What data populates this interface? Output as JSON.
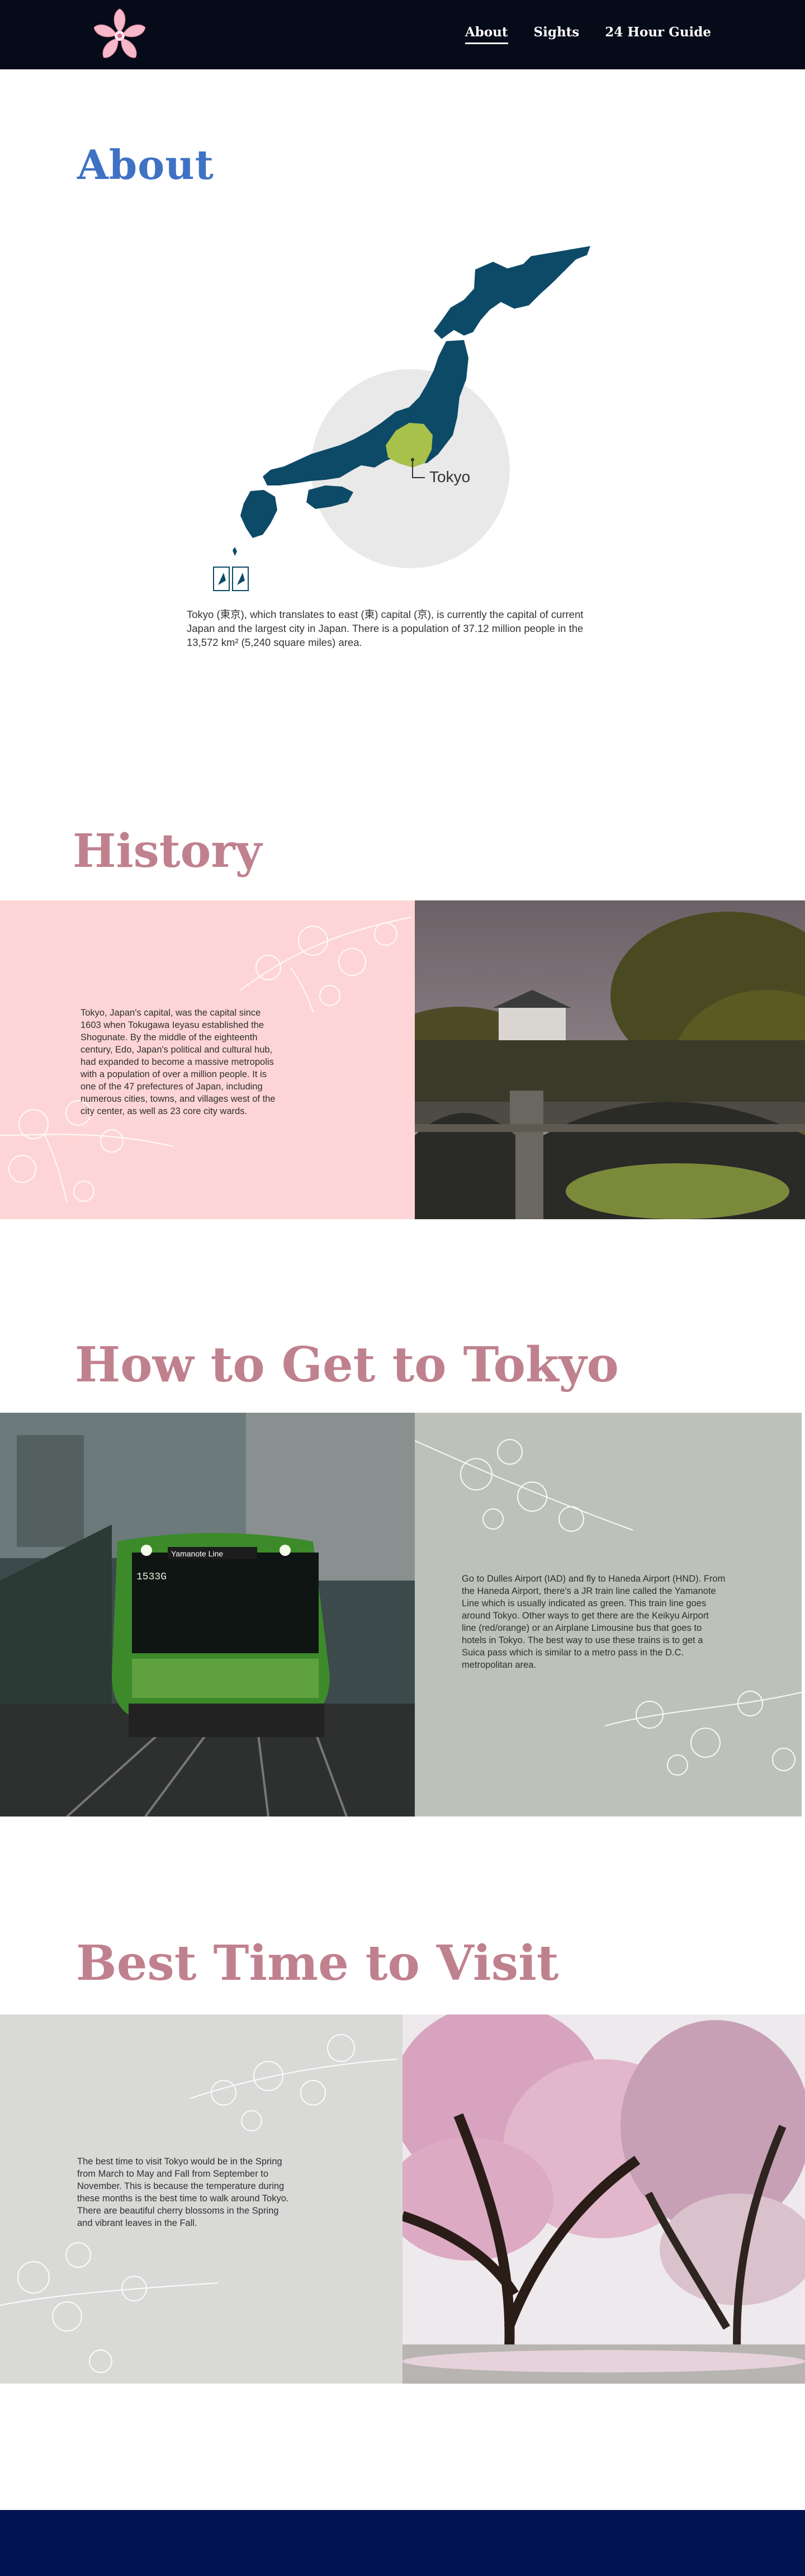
{
  "nav": {
    "logo_icon": "cherry-blossom-icon",
    "links": [
      {
        "label": "About",
        "active": true
      },
      {
        "label": "Sights",
        "active": false
      },
      {
        "label": "24 Hour Guide",
        "active": false
      }
    ]
  },
  "about": {
    "title": "About",
    "map_label": "Tokyo",
    "description": "Tokyo (東京), which translates to east (東) capital (京), is currently the capital of current Japan and the largest city in Japan. There is a population of 37.12 million people in the 13,572 km² (5,240 square miles) area."
  },
  "history": {
    "title": "History",
    "text": "Tokyo, Japan's capital, was the capital since 1603 when Tokugawa Ieyasu established the Shogunate. By the middle of the eighteenth century, Edo, Japan's political and cultural hub, had expanded to become a massive metropolis with a population of over a million people. It is one of the 47 prefectures of Japan, including numerous cities, towns, and villages west of the city center, as well as 23 core city wards."
  },
  "how_to_get": {
    "title": "How to Get to Tokyo",
    "train_sign": "Yamanote Line",
    "train_number": "1533G",
    "text": "Go to Dulles Airport (IAD) and fly to Haneda Airport (HND). From the Haneda Airport, there's a JR train line called the Yamanote Line which is usually indicated as green. This train line goes around Tokyo. Other ways to get there are the Keikyu Airport line (red/orange) or an Airplane Limousine bus that goes to hotels in Tokyo. The best way to use these trains is to get a Suica pass which is similar to a metro pass in the D.C. metropolitan area."
  },
  "best_time": {
    "title": "Best Time to Visit",
    "text": "The best time to visit Tokyo would be in the Spring from March to May and Fall from September to November. This is because the temperature during these months is the best time to walk around Tokyo. There are beautiful cherry blossoms in the Spring and vibrant leaves in the Fall."
  },
  "colors": {
    "nav_bg": "#050b18",
    "about_title": "#3f72c4",
    "section_title": "#c0818e",
    "history_panel": "#fed5d6",
    "howto_panel": "#bdc2b9",
    "best_panel": "#d9dad8",
    "footer": "#021353",
    "map_fill": "#0d4a67",
    "tokyo_highlight": "#a7c14b"
  }
}
